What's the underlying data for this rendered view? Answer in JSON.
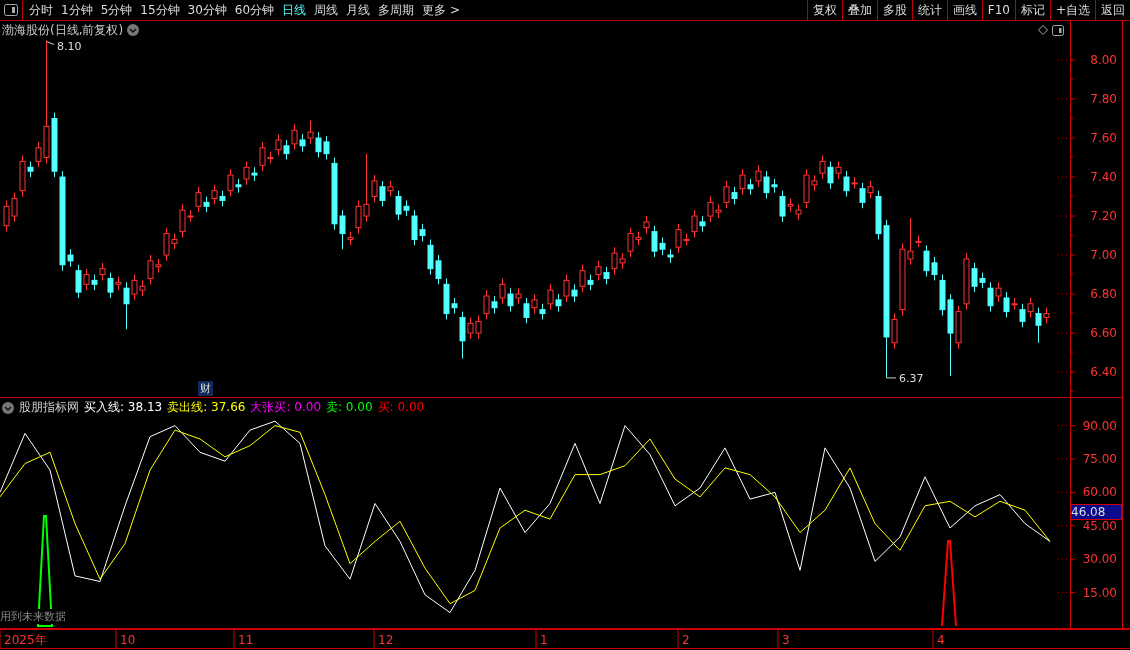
{
  "toolbar": {
    "periods": [
      {
        "label": "分时",
        "selected": false
      },
      {
        "label": "1分钟",
        "selected": false
      },
      {
        "label": "5分钟",
        "selected": false
      },
      {
        "label": "15分钟",
        "selected": false
      },
      {
        "label": "30分钟",
        "selected": false
      },
      {
        "label": "60分钟",
        "selected": false
      },
      {
        "label": "日线",
        "selected": true
      },
      {
        "label": "周线",
        "selected": false
      },
      {
        "label": "月线",
        "selected": false
      },
      {
        "label": "多周期",
        "selected": false
      },
      {
        "label": "更多 >",
        "selected": false
      }
    ],
    "actions": [
      "复权",
      "叠加",
      "多股",
      "统计",
      "画线",
      "F10",
      "标记",
      "+自选",
      "返回"
    ]
  },
  "price_panel": {
    "title": "渤海股份(日线,前复权)",
    "high_label": "8.10",
    "low_label": "6.37",
    "badge": "财",
    "chart_data": {
      "type": "candlestick",
      "ylim": [
        6.267,
        8.2
      ],
      "yticks": [
        {
          "value": 8,
          "label": "8.00"
        },
        {
          "value": 7.8,
          "label": "7.80"
        },
        {
          "value": 7.6,
          "label": "7.60"
        },
        {
          "value": 7.4,
          "label": "7.40"
        },
        {
          "value": 7.2,
          "label": "7.20"
        },
        {
          "value": 7,
          "label": "7.00"
        },
        {
          "value": 6.8,
          "label": "6.80"
        },
        {
          "value": 6.6,
          "label": "6.60"
        },
        {
          "value": 6.4,
          "label": "6.40"
        }
      ],
      "ohlc": [
        [
          7.15,
          7.28,
          7.12,
          7.25
        ],
        [
          7.2,
          7.32,
          7.17,
          7.29
        ],
        [
          7.33,
          7.51,
          7.3,
          7.48
        ],
        [
          7.45,
          7.48,
          7.4,
          7.43
        ],
        [
          7.48,
          7.58,
          7.45,
          7.55
        ],
        [
          7.5,
          8.1,
          7.47,
          7.66
        ],
        [
          7.7,
          7.73,
          7.4,
          7.43
        ],
        [
          7.4,
          7.43,
          6.92,
          6.95
        ],
        [
          7.0,
          7.03,
          6.94,
          6.97
        ],
        [
          6.92,
          6.95,
          6.78,
          6.81
        ],
        [
          6.85,
          6.93,
          6.82,
          6.9
        ],
        [
          6.87,
          6.9,
          6.82,
          6.85
        ],
        [
          6.9,
          6.96,
          6.87,
          6.93
        ],
        [
          6.88,
          6.91,
          6.78,
          6.81
        ],
        [
          6.85,
          6.89,
          6.82,
          6.86
        ],
        [
          6.83,
          6.86,
          6.62,
          6.75
        ],
        [
          6.8,
          6.9,
          6.77,
          6.87
        ],
        [
          6.82,
          6.87,
          6.79,
          6.84
        ],
        [
          6.88,
          7.0,
          6.85,
          6.97
        ],
        [
          6.94,
          6.98,
          6.91,
          6.95
        ],
        [
          7.0,
          7.14,
          6.97,
          7.11
        ],
        [
          7.06,
          7.11,
          7.03,
          7.08
        ],
        [
          7.12,
          7.26,
          7.09,
          7.23
        ],
        [
          7.2,
          7.23,
          7.17,
          7.2
        ],
        [
          7.25,
          7.35,
          7.22,
          7.32
        ],
        [
          7.27,
          7.3,
          7.22,
          7.25
        ],
        [
          7.29,
          7.36,
          7.26,
          7.33
        ],
        [
          7.3,
          7.33,
          7.25,
          7.28
        ],
        [
          7.33,
          7.44,
          7.3,
          7.41
        ],
        [
          7.36,
          7.39,
          7.32,
          7.35
        ],
        [
          7.39,
          7.48,
          7.36,
          7.45
        ],
        [
          7.42,
          7.45,
          7.38,
          7.41
        ],
        [
          7.46,
          7.58,
          7.43,
          7.55
        ],
        [
          7.5,
          7.53,
          7.47,
          7.5
        ],
        [
          7.54,
          7.62,
          7.51,
          7.59
        ],
        [
          7.56,
          7.59,
          7.49,
          7.52
        ],
        [
          7.57,
          7.67,
          7.54,
          7.64
        ],
        [
          7.59,
          7.62,
          7.53,
          7.56
        ],
        [
          7.6,
          7.69,
          7.57,
          7.63
        ],
        [
          7.6,
          7.63,
          7.5,
          7.53
        ],
        [
          7.58,
          7.61,
          7.49,
          7.52
        ],
        [
          7.47,
          7.5,
          7.13,
          7.16
        ],
        [
          7.2,
          7.23,
          7.03,
          7.11
        ],
        [
          7.08,
          7.12,
          7.05,
          7.09
        ],
        [
          7.14,
          7.28,
          7.11,
          7.25
        ],
        [
          7.2,
          7.52,
          7.17,
          7.26
        ],
        [
          7.3,
          7.41,
          7.27,
          7.38
        ],
        [
          7.35,
          7.38,
          7.25,
          7.28
        ],
        [
          7.33,
          7.38,
          7.3,
          7.35
        ],
        [
          7.3,
          7.33,
          7.18,
          7.21
        ],
        [
          7.25,
          7.28,
          7.2,
          7.23
        ],
        [
          7.2,
          7.23,
          7.05,
          7.08
        ],
        [
          7.13,
          7.16,
          7.07,
          7.1
        ],
        [
          7.05,
          7.08,
          6.9,
          6.93
        ],
        [
          6.97,
          7.0,
          6.85,
          6.88
        ],
        [
          6.85,
          6.88,
          6.67,
          6.7
        ],
        [
          6.75,
          6.78,
          6.7,
          6.73
        ],
        [
          6.68,
          6.71,
          6.47,
          6.56
        ],
        [
          6.6,
          6.68,
          6.57,
          6.65
        ],
        [
          6.6,
          6.69,
          6.57,
          6.66
        ],
        [
          6.7,
          6.82,
          6.67,
          6.79
        ],
        [
          6.76,
          6.79,
          6.7,
          6.73
        ],
        [
          6.78,
          6.88,
          6.75,
          6.85
        ],
        [
          6.8,
          6.83,
          6.71,
          6.74
        ],
        [
          6.78,
          6.83,
          6.75,
          6.8
        ],
        [
          6.75,
          6.78,
          6.65,
          6.68
        ],
        [
          6.73,
          6.8,
          6.7,
          6.77
        ],
        [
          6.72,
          6.75,
          6.67,
          6.7
        ],
        [
          6.75,
          6.85,
          6.72,
          6.82
        ],
        [
          6.77,
          6.8,
          6.71,
          6.74
        ],
        [
          6.79,
          6.9,
          6.76,
          6.87
        ],
        [
          6.82,
          6.85,
          6.76,
          6.79
        ],
        [
          6.84,
          6.95,
          6.81,
          6.92
        ],
        [
          6.87,
          6.9,
          6.82,
          6.85
        ],
        [
          6.9,
          6.97,
          6.87,
          6.94
        ],
        [
          6.91,
          6.94,
          6.85,
          6.88
        ],
        [
          6.93,
          7.04,
          6.9,
          7.01
        ],
        [
          6.96,
          7.01,
          6.93,
          6.98
        ],
        [
          7.02,
          7.14,
          6.99,
          7.11
        ],
        [
          7.08,
          7.12,
          7.05,
          7.09
        ],
        [
          7.14,
          7.2,
          7.11,
          7.17
        ],
        [
          7.12,
          7.15,
          6.99,
          7.02
        ],
        [
          7.06,
          7.09,
          7.0,
          7.03
        ],
        [
          7.0,
          7.03,
          6.96,
          6.99
        ],
        [
          7.04,
          7.16,
          7.01,
          7.13
        ],
        [
          7.08,
          7.11,
          7.05,
          7.08
        ],
        [
          7.12,
          7.23,
          7.09,
          7.2
        ],
        [
          7.17,
          7.2,
          7.12,
          7.15
        ],
        [
          7.2,
          7.3,
          7.17,
          7.27
        ],
        [
          7.22,
          7.26,
          7.19,
          7.23
        ],
        [
          7.27,
          7.38,
          7.24,
          7.35
        ],
        [
          7.32,
          7.35,
          7.26,
          7.29
        ],
        [
          7.34,
          7.44,
          7.31,
          7.41
        ],
        [
          7.36,
          7.39,
          7.31,
          7.34
        ],
        [
          7.38,
          7.46,
          7.35,
          7.43
        ],
        [
          7.4,
          7.43,
          7.29,
          7.32
        ],
        [
          7.36,
          7.39,
          7.32,
          7.35
        ],
        [
          7.3,
          7.33,
          7.17,
          7.2
        ],
        [
          7.25,
          7.29,
          7.22,
          7.26
        ],
        [
          7.21,
          7.26,
          7.18,
          7.23
        ],
        [
          7.27,
          7.44,
          7.24,
          7.41
        ],
        [
          7.36,
          7.41,
          7.33,
          7.38
        ],
        [
          7.42,
          7.51,
          7.39,
          7.48
        ],
        [
          7.45,
          7.48,
          7.34,
          7.37
        ],
        [
          7.42,
          7.48,
          7.39,
          7.45
        ],
        [
          7.4,
          7.43,
          7.3,
          7.33
        ],
        [
          7.37,
          7.4,
          7.34,
          7.37
        ],
        [
          7.34,
          7.37,
          7.24,
          7.27
        ],
        [
          7.32,
          7.38,
          7.29,
          7.35
        ],
        [
          7.3,
          7.33,
          7.08,
          7.11
        ],
        [
          7.15,
          7.18,
          6.37,
          6.58
        ],
        [
          6.55,
          6.7,
          6.52,
          6.67
        ],
        [
          6.72,
          7.06,
          6.69,
          7.03
        ],
        [
          6.98,
          7.19,
          6.95,
          7.02
        ],
        [
          7.07,
          7.1,
          7.04,
          7.07
        ],
        [
          7.02,
          7.05,
          6.89,
          6.92
        ],
        [
          6.96,
          6.99,
          6.87,
          6.9
        ],
        [
          6.87,
          6.9,
          6.69,
          6.72
        ],
        [
          6.77,
          6.8,
          6.38,
          6.6
        ],
        [
          6.55,
          6.74,
          6.52,
          6.71
        ],
        [
          6.75,
          7.01,
          6.72,
          6.98
        ],
        [
          6.93,
          6.96,
          6.81,
          6.84
        ],
        [
          6.88,
          6.91,
          6.83,
          6.86
        ],
        [
          6.83,
          6.86,
          6.71,
          6.74
        ],
        [
          6.79,
          6.86,
          6.76,
          6.83
        ],
        [
          6.78,
          6.81,
          6.68,
          6.71
        ],
        [
          6.75,
          6.78,
          6.72,
          6.75
        ],
        [
          6.72,
          6.75,
          6.63,
          6.66
        ],
        [
          6.71,
          6.78,
          6.68,
          6.75
        ],
        [
          6.7,
          6.73,
          6.55,
          6.64
        ],
        [
          6.68,
          6.73,
          6.65,
          6.7
        ]
      ]
    }
  },
  "indicator_panel": {
    "name": "股朋指标网",
    "values": [
      {
        "label": "买入线: 38.13",
        "color": "#ffffff"
      },
      {
        "label": "卖出线: 37.66",
        "color": "#ffff00"
      },
      {
        "label": "大张买: 0.00",
        "color": "#ff00ff"
      },
      {
        "label": "卖: 0.00",
        "color": "#00ff00"
      },
      {
        "label": "买: 0.00",
        "color": "#ff0000"
      }
    ],
    "current_value": "46.08",
    "warning": "用到未来数据",
    "chart_data": {
      "type": "line",
      "ylim": [
        -0.9,
        102.4
      ],
      "yticks": [
        {
          "value": 90,
          "label": "90.00"
        },
        {
          "value": 75,
          "label": "75.00"
        },
        {
          "value": 60,
          "label": "60.00"
        },
        {
          "value": 45,
          "label": "45.00"
        },
        {
          "value": 30,
          "label": "30.00"
        },
        {
          "value": 15,
          "label": "15.00"
        }
      ],
      "categories": [
        null,
        null,
        null,
        null,
        null,
        null,
        null,
        null,
        null,
        null,
        null,
        null,
        null,
        null,
        null,
        null,
        null,
        null,
        null,
        null,
        null,
        null,
        null,
        null,
        null,
        null,
        null,
        null,
        null,
        null,
        null,
        null,
        null,
        null,
        null,
        null,
        null,
        null,
        null,
        null,
        null,
        null,
        null
      ],
      "series": [
        {
          "color": "#ffffff",
          "values": [
            60,
            86.5,
            70,
            22.5,
            20,
            54,
            85,
            90,
            78,
            74,
            88,
            92,
            82,
            36,
            21,
            55,
            38,
            14,
            6,
            25,
            62,
            42,
            55,
            82,
            55,
            90,
            77,
            54,
            62,
            80,
            57,
            60,
            25,
            80,
            62,
            29,
            40,
            67,
            44,
            54,
            59,
            46,
            38
          ]
        },
        {
          "color": "#ffff00",
          "values": [
            58,
            73,
            78,
            46,
            21,
            37,
            70,
            88,
            84,
            76,
            81,
            90,
            87,
            59,
            28,
            38,
            47,
            26,
            10,
            16,
            44,
            52,
            48,
            68,
            68,
            72,
            84,
            66,
            58,
            71,
            68,
            58,
            42,
            52,
            71,
            46,
            34,
            54,
            56,
            49,
            56,
            52,
            38
          ]
        }
      ]
    }
  },
  "time_axis": {
    "labels": [
      "2025年",
      "10",
      "11",
      "12",
      "1",
      "2",
      "3",
      "4"
    ]
  }
}
